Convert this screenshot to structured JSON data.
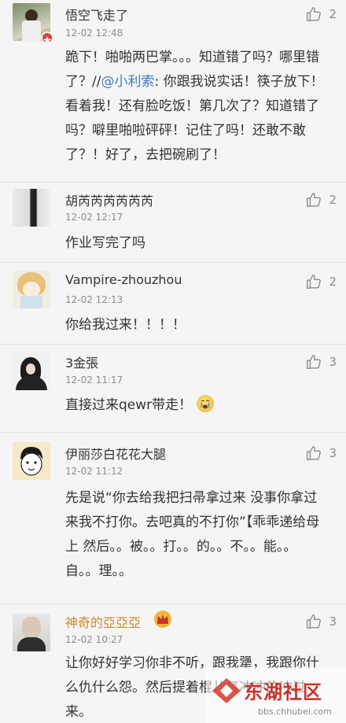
{
  "comments": [
    {
      "name": "悟空飞走了",
      "time": "12-02 12:48",
      "likes": "2",
      "body_prefix": "跪下！啪啪两巴掌。。。知道错了吗？哪里错了？//",
      "mention": "@小利索",
      "body_suffix": ": 你跟我说实话！筷子放下！看着我！还有脸吃饭！第几次了？知道错了吗？噼里啪啦砰砰！记住了吗！还敢不敢了？！好了，去把碗刷了！"
    },
    {
      "name": "胡芮芮芮芮芮芮",
      "time": "12-02 12:17",
      "likes": "2",
      "body": "作业写完了吗"
    },
    {
      "name": "Vampire-zhouzhou",
      "time": "12-02 12:13",
      "likes": "2",
      "body": "你给我过来！！！！"
    },
    {
      "name": "3金張",
      "time": "12-02 11:17",
      "likes": "3",
      "body": "直接过来qewr带走！"
    },
    {
      "name": "伊丽莎白花花大腿",
      "time": "12-02 11:12",
      "likes": "3",
      "body": "先是说“你去给我把扫帚拿过来 没事你拿过来我不打你。去吧真的不打你”【乖乖递给母上 然后。。被。。打。。的。。不。。能。。自。。理。。"
    },
    {
      "name": "神奇的亞亞亞",
      "time": "12-02 10:27",
      "likes": "3",
      "body": "让你好好学习你非不听，跟我犟，我跟你什么仇什么怨。然后提着棍儿气冲冲的冲过来。"
    }
  ],
  "watermark": {
    "title": "东湖社区",
    "url": "bbs.chhubei.com"
  },
  "colors": {
    "mention": "#3b7fc0",
    "gold_name": "#d28a2a",
    "watermark_red": "#c8342c"
  }
}
